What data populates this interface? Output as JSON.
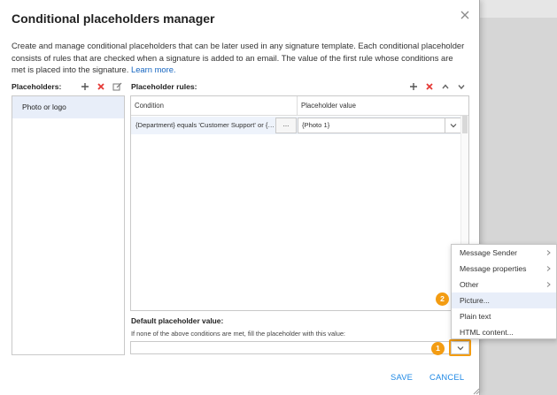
{
  "dialog": {
    "title": "Conditional placeholders manager",
    "description": "Create and manage conditional placeholders that can be later used in any signature template. Each conditional placeholder consists of rules that are checked when a signature is added to an email. The value of the first rule whose conditions are met is placed into the signature.",
    "learn_more": "Learn more."
  },
  "placeholders": {
    "label": "Placeholders:",
    "items": [
      "Photo or logo"
    ]
  },
  "rules": {
    "label": "Placeholder rules:",
    "columns": [
      "Condition",
      "Placeholder value"
    ],
    "rows": [
      {
        "condition": "{Department} equals 'Customer Support' or {De...",
        "button": "...",
        "value": "{Photo 1}"
      }
    ]
  },
  "default": {
    "label": "Default placeholder value:",
    "hint": "If none of the above conditions are met, fill the placeholder with this value:",
    "value": ""
  },
  "footer": {
    "save": "SAVE",
    "cancel": "CANCEL"
  },
  "context_menu": {
    "items": [
      {
        "label": "Message Sender"
      },
      {
        "label": "Message properties"
      },
      {
        "label": "Other"
      },
      {
        "label": "Picture..."
      },
      {
        "label": "Plain text"
      },
      {
        "label": "HTML content..."
      }
    ]
  },
  "badges": [
    "1",
    "2"
  ],
  "colors": {
    "accent": "#1e88e5",
    "delete": "#e53935",
    "highlight": "#f39c12",
    "selected": "#e8eef9"
  }
}
